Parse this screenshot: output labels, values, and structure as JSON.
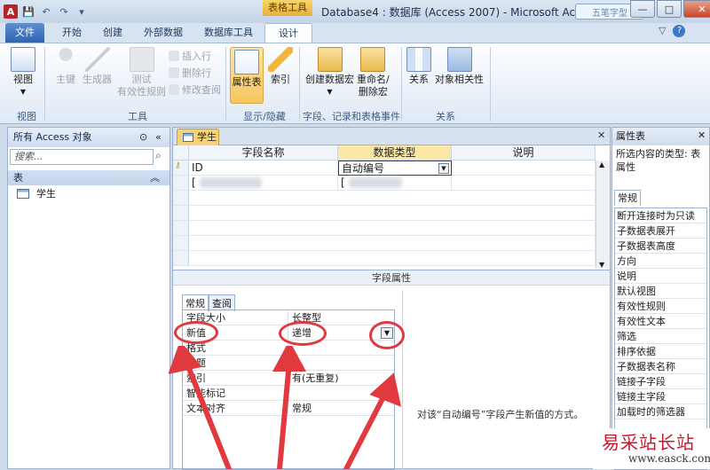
{
  "window": {
    "app_icon": "A",
    "context_tab": "表格工具",
    "title": "Database4 : 数据库 (Access 2007)  -  Microsoft Access",
    "overlay_badge": "五笔字型",
    "minimize": "—",
    "maximize": "□",
    "close": "✕"
  },
  "qat": {
    "save_icon": "💾",
    "undo_icon": "↶",
    "redo_icon": "↷",
    "customize_icon": "▾"
  },
  "tabs": [
    "文件",
    "开始",
    "创建",
    "外部数据",
    "数据库工具",
    "设计"
  ],
  "ribbon_right": {
    "collapse": "▽",
    "help": "?"
  },
  "ribbon": {
    "view": {
      "label": "视图",
      "group": "视图"
    },
    "tools": {
      "primary_key": "主键",
      "builder": "生成器",
      "test_rules": "测试\n有效性规则",
      "insert_rows": "插入行",
      "delete_rows": "删除行",
      "modify_lookups": "修改查阅",
      "group": "工具"
    },
    "show_hide": {
      "property_sheet": "属性表",
      "indexes": "索引",
      "group": "显示/隐藏"
    },
    "events": {
      "create_macro": "创建数据宏",
      "rename_macro": "重命名/\n删除宏",
      "group": "字段、记录和表格事件"
    },
    "relationships": {
      "relationships": "关系",
      "object_dependencies": "对象相关性",
      "group": "关系"
    }
  },
  "nav": {
    "header": "所有 Access 对象",
    "search_placeholder": "搜索...",
    "group": "表",
    "items": [
      "学生"
    ]
  },
  "document": {
    "tab": "学生",
    "columns": [
      "字段名称",
      "数据类型",
      "说明"
    ],
    "rows": [
      {
        "name": "ID",
        "type": "自动编号",
        "desc": ""
      },
      {
        "name": "[",
        "type": "[",
        "desc": ""
      }
    ],
    "field_props_label": "字段属性",
    "fp_tabs": [
      "常规",
      "查阅"
    ],
    "props": [
      {
        "k": "字段大小",
        "v": "长整型"
      },
      {
        "k": "新值",
        "v": "递增"
      },
      {
        "k": "格式",
        "v": ""
      },
      {
        "k": "标题",
        "v": ""
      },
      {
        "k": "索引",
        "v": "有(无重复)"
      },
      {
        "k": "智能标记",
        "v": ""
      },
      {
        "k": "文本对齐",
        "v": "常规"
      }
    ],
    "help_text": "对该“自动编号”字段产生新值的方式。"
  },
  "property_sheet": {
    "title": "属性表",
    "close": "✕",
    "selection_type": "所选内容的类型: 表属性",
    "tab": "常规",
    "items": [
      "断开连接时为只读",
      "子数据表展开",
      "子数据表高度",
      "方向",
      "说明",
      "默认视图",
      "有效性规则",
      "有效性文本",
      "筛选",
      "排序依据",
      "子数据表名称",
      "链接子字段",
      "链接主字段",
      "加载时的筛选器"
    ]
  },
  "watermark": {
    "name": "易采站长站",
    "url": "www.easck.com"
  },
  "colors": {
    "accent": "#2e64b3",
    "annotation": "#e03a3f",
    "context": "#eab03c"
  }
}
